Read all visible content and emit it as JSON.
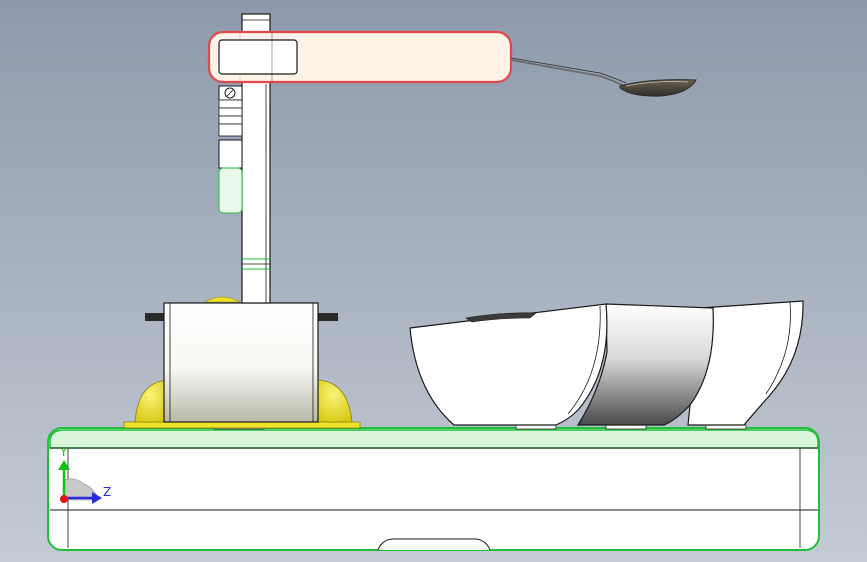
{
  "scene": {
    "view": "side-elevation",
    "background_top": "#8e9aac",
    "background_bottom": "#c4cbd4",
    "parts": [
      "base-plate",
      "column",
      "motor-block",
      "feed-bowls",
      "spoon-arm",
      "spoon",
      "yellow-bumpers"
    ],
    "colors": {
      "edge_green": "#1fbf3a",
      "highlight_red": "#e0474a",
      "bumper_yellow": "#f0e22a",
      "body_white": "#ffffff",
      "arm_fill": "#fdf3e6"
    }
  },
  "triad": {
    "y_label": "Y",
    "z_label": "Z",
    "y_color": "#16c116",
    "z_color": "#2a2ae0",
    "origin_color": "#e01515"
  }
}
